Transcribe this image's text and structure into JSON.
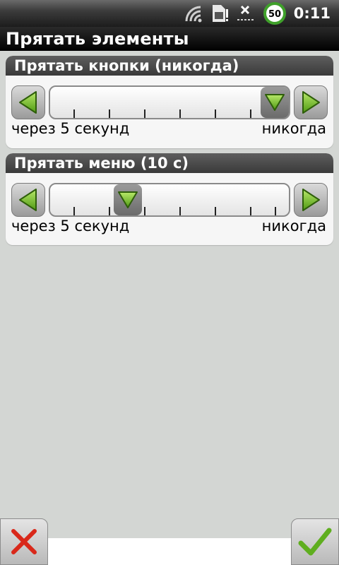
{
  "status_bar": {
    "time": "0:11",
    "battery_level": "50",
    "icons": [
      "wifi-icon",
      "sim-card-icon",
      "no-signal-icon",
      "battery-icon"
    ]
  },
  "screen": {
    "title": "Прятать элементы"
  },
  "settings": [
    {
      "header": "Прятать кнопки (никогда)",
      "min_label": "через 5 секунд",
      "max_label": "никогда",
      "value_fraction": 1.0
    },
    {
      "header": "Прятать меню (10 с)",
      "min_label": "через 5 секунд",
      "max_label": "никогда",
      "value_fraction": 0.2
    }
  ],
  "actions": {
    "cancel_icon": "close-icon",
    "confirm_icon": "checkmark-icon"
  },
  "colors": {
    "accent_green": "#5fae1f",
    "cancel_red": "#d9281a"
  }
}
